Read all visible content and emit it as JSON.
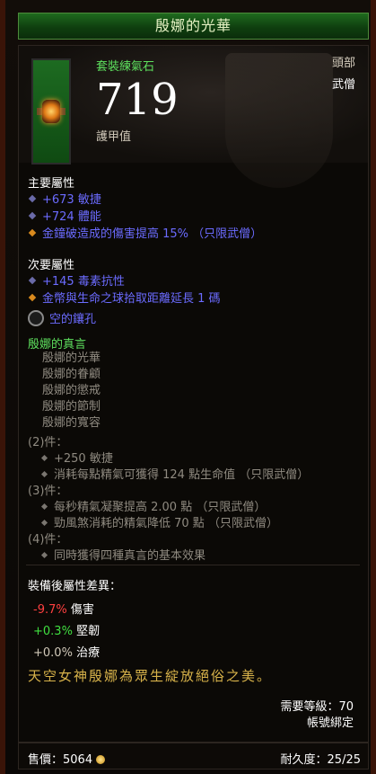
{
  "item": {
    "name": "殷娜的光華",
    "type": "套裝練氣石",
    "armor_value": "719",
    "armor_label": "護甲值",
    "slot": "頭部",
    "class": "武僧"
  },
  "primary": {
    "title": "主要屬性",
    "affixes": [
      {
        "text": "+673 敏捷",
        "bullet": "blue"
      },
      {
        "text": "+724 體能",
        "bullet": "blue"
      },
      {
        "text": "金鐘破造成的傷害提高 15% （只限武僧）",
        "bullet": "gold"
      }
    ]
  },
  "secondary": {
    "title": "次要屬性",
    "affixes": [
      {
        "text": "+145 毒素抗性",
        "bullet": "blue"
      },
      {
        "text": "金幣與生命之球拾取距離延長 1 碼",
        "bullet": "gold"
      }
    ]
  },
  "socket_label": "空的鑲孔",
  "set": {
    "name": "殷娜的真言",
    "items": [
      "殷娜的光華",
      "殷娜的眷顧",
      "殷娜的懲戒",
      "殷娜的節制",
      "殷娜的寬容"
    ],
    "bonuses": [
      {
        "label": "(2)件：",
        "effects": [
          "+250 敏捷",
          "消耗每點精氣可獲得 124 點生命值 （只限武僧）"
        ]
      },
      {
        "label": "(3)件：",
        "effects": [
          "每秒精氣凝聚提高 2.00 點 （只限武僧）",
          "勁風煞消耗的精氣降低 70 點 （只限武僧）"
        ]
      },
      {
        "label": "(4)件：",
        "effects": [
          "同時獲得四種真言的基本效果"
        ]
      }
    ]
  },
  "comparison": {
    "title": "裝備後屬性差異：",
    "rows": [
      {
        "delta": "-9.7%",
        "label": "傷害",
        "color": "#ff4040"
      },
      {
        "delta": "+0.3%",
        "label": "堅韌",
        "color": "#40e040"
      },
      {
        "delta": "+0.0%",
        "label": "治療",
        "color": "#d0c8b8"
      }
    ]
  },
  "flavor_text": "天空女神殷娜為眾生綻放絕俗之美。",
  "requirements": {
    "level": "需要等級：70",
    "binding": "帳號綁定"
  },
  "footer": {
    "price_label": "售價：5064",
    "durability_label": "耐久度：25/25"
  },
  "colors": {
    "set_green": "#5ee05e",
    "magic_blue": "#6b6bff",
    "legendary_gold": "#d98a1e",
    "flavor_gold": "#d7b24a"
  }
}
